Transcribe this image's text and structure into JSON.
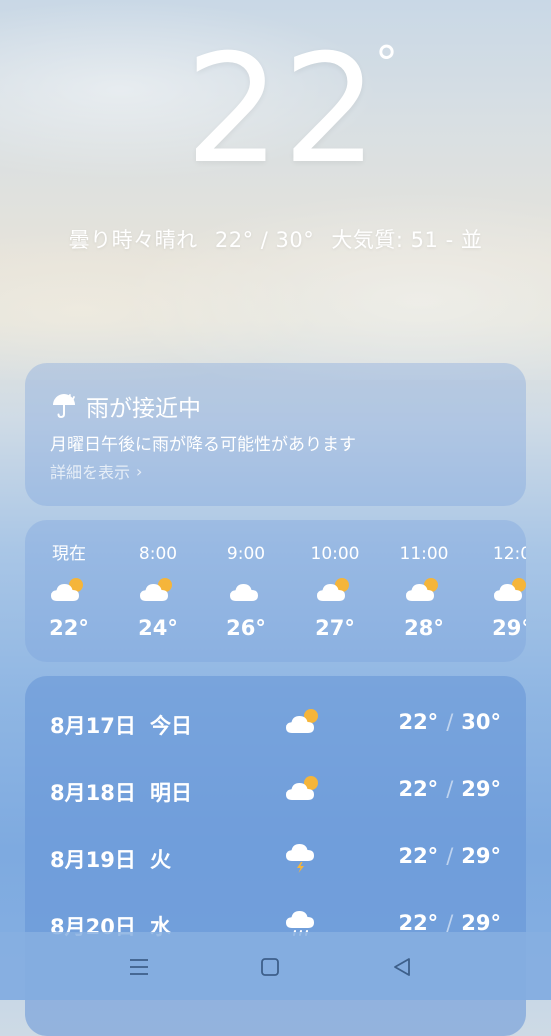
{
  "current": {
    "temperature": "22",
    "degree_symbol": "°",
    "condition": "曇り時々晴れ",
    "range": "22° / 30°",
    "air_quality": "大気質: 51 - 並"
  },
  "alert": {
    "icon": "umbrella-icon",
    "title": "雨が接近中",
    "description": "月曜日午後に雨が降る可能性があります",
    "link": "詳細を表示",
    "link_icon": "chevron-right-icon"
  },
  "hourly": [
    {
      "time": "現在",
      "icon": "partly-cloudy-icon",
      "temp": "22°"
    },
    {
      "time": "8:00",
      "icon": "partly-cloudy-icon",
      "temp": "24°"
    },
    {
      "time": "9:00",
      "icon": "cloudy-icon",
      "temp": "26°"
    },
    {
      "time": "10:00",
      "icon": "partly-cloudy-icon",
      "temp": "27°"
    },
    {
      "time": "11:00",
      "icon": "partly-cloudy-icon",
      "temp": "28°"
    },
    {
      "time": "12:0",
      "icon": "partly-cloudy-icon",
      "temp": "29°"
    }
  ],
  "daily": [
    {
      "date": "8月17日",
      "day": "今日",
      "icon": "partly-cloudy-icon",
      "low": "22°",
      "separator": "/",
      "high": "30°"
    },
    {
      "date": "8月18日",
      "day": "明日",
      "icon": "partly-cloudy-icon",
      "low": "22°",
      "separator": "/",
      "high": "29°"
    },
    {
      "date": "8月19日",
      "day": "火",
      "icon": "thunderstorm-icon",
      "low": "22°",
      "separator": "/",
      "high": "29°"
    },
    {
      "date": "8月20日",
      "day": "水",
      "icon": "rain-cloud-icon",
      "low": "22°",
      "separator": "/",
      "high": "29°"
    }
  ],
  "navbar": {
    "menu_icon": "menu-icon",
    "home_icon": "home-square-icon",
    "back_icon": "back-triangle-icon"
  },
  "colors": {
    "sun": "#f5b53a",
    "cloud": "#ffffff",
    "bolt": "#f5b53a"
  }
}
